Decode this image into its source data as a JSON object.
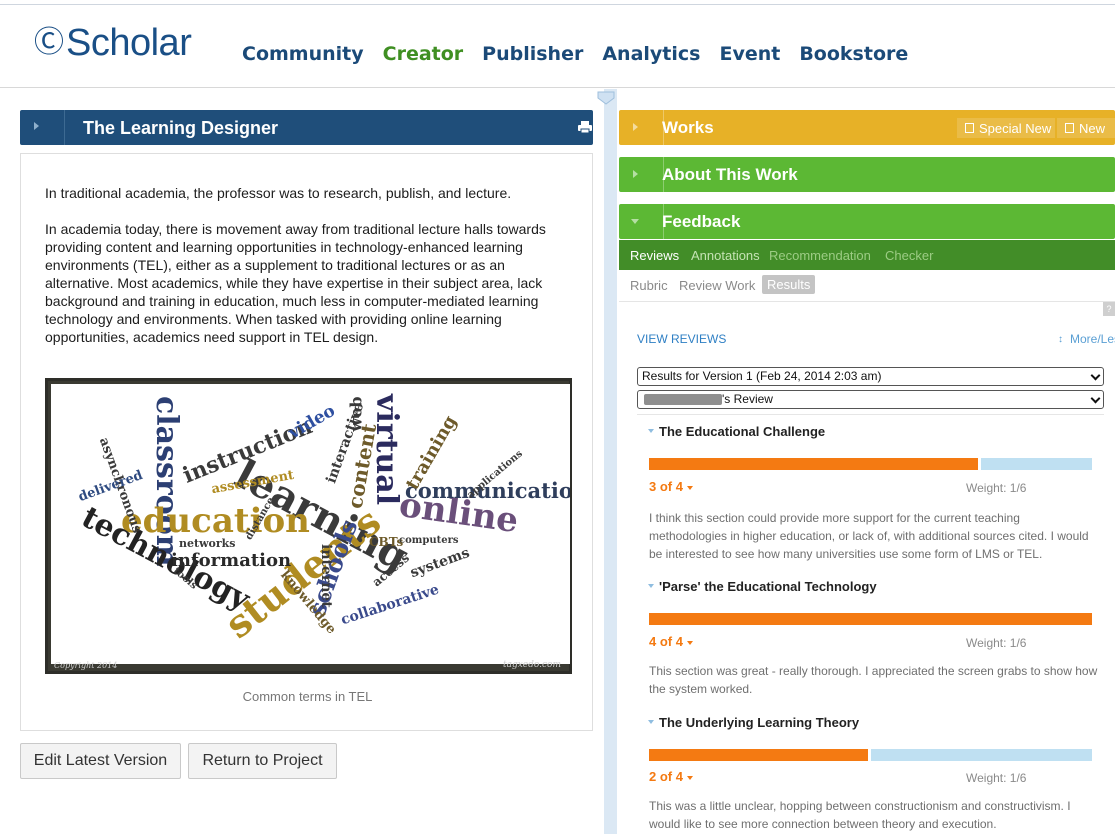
{
  "brand": {
    "logo_text": "Scholar"
  },
  "nav": {
    "items": [
      "Community",
      "Creator",
      "Publisher",
      "Analytics",
      "Event",
      "Bookstore"
    ],
    "active": "Creator"
  },
  "colors": {
    "primary": "#1f4e7a",
    "creator_green": "#3f8f22",
    "works_yellow": "#e7b127",
    "panel_green": "#5cb834",
    "score_orange": "#f47a12",
    "score_track": "#bfe0f2"
  },
  "left": {
    "title": "The Learning Designer",
    "print_icon": "print-icon",
    "para1": "In traditional academia, the professor was to research, publish, and lecture.",
    "para2": "In academia today, there is movement away from traditional lecture halls towards providing content and learning opportunities in technology-enhanced learning environments (TEL), either as a supplement to traditional lectures or as an alternative. Most academics, while they have expertise in their subject area, lack background and training in education, much less in computer-mediated learning technology and environments. When tasked with providing online learning opportunities, academics need support in TEL design.",
    "wordcloud": {
      "copyright": "Copyright 2014",
      "credit": "tagxedo.com",
      "words": [
        "classroom",
        "instruction",
        "video",
        "web",
        "virtual",
        "interactive",
        "content",
        "learning",
        "education",
        "online",
        "communication",
        "training",
        "technology",
        "students",
        "schools",
        "information",
        "asynchronous",
        "delivered",
        "assessment",
        "networks",
        "internet",
        "collaborative",
        "knowledge",
        "access",
        "systems",
        "computers",
        "CBTs",
        "tools",
        "distance",
        "applications"
      ]
    },
    "caption": "Common terms in TEL",
    "buttons": {
      "edit": "Edit Latest Version",
      "return": "Return to Project"
    }
  },
  "right": {
    "works": {
      "title": "Works",
      "special_new": "Special New",
      "new": "New"
    },
    "about": {
      "title": "About This Work"
    },
    "feedback": {
      "title": "Feedback",
      "tabs": [
        "Reviews",
        "Annotations",
        "Recommendation",
        "Checker"
      ],
      "active_tab": "Reviews",
      "subtabs": [
        "Rubric",
        "Review Work",
        "Results"
      ],
      "active_subtab": "Results",
      "view_reviews": "VIEW REVIEWS",
      "more_less": "More/Less",
      "version_select": "Results for Version 1 (Feb 24, 2014 2:03 am)",
      "reviewer_select": "'s Review",
      "sections": [
        {
          "title": "The Educational Challenge",
          "score": 3,
          "max": 4,
          "score_label": "3 of 4",
          "weight": "Weight: 1/6",
          "comment": "I think this section could provide more support for the current teaching methodologies in higher education, or lack of, with additional sources cited. I would be interested to see how many universities use some form of LMS or TEL."
        },
        {
          "title": "'Parse' the Educational Technology",
          "score": 4,
          "max": 4,
          "score_label": "4 of 4",
          "weight": "Weight: 1/6",
          "comment": "This section was great - really thorough. I appreciated the screen grabs to show how the system worked."
        },
        {
          "title": "The Underlying Learning Theory",
          "score": 2,
          "max": 4,
          "score_label": "2 of 4",
          "weight": "Weight: 1/6",
          "comment": "This was a little unclear, hopping between constructionism and constructivism. I would like to see more connection between theory and execution."
        }
      ]
    }
  }
}
